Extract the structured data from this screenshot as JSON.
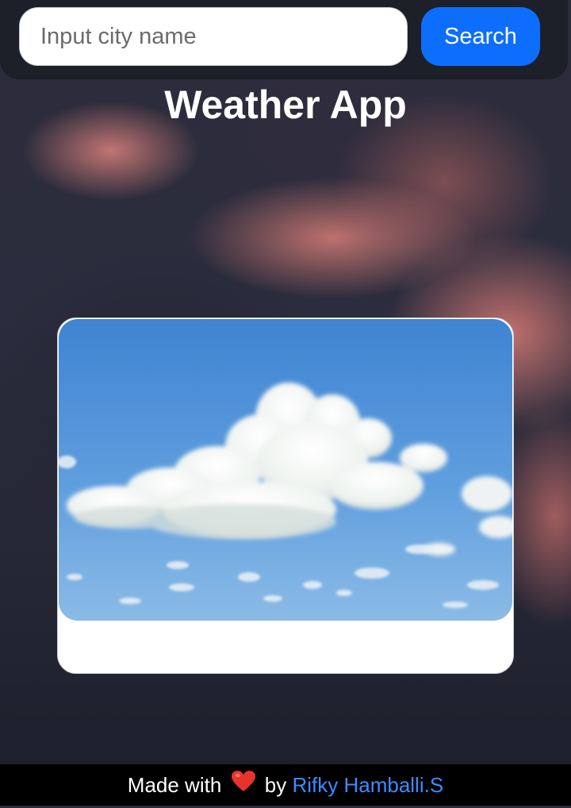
{
  "search": {
    "placeholder": "Input city name",
    "value": "",
    "button_label": "Search"
  },
  "header": {
    "title": "Weather App"
  },
  "weather_card": {
    "image_icon": "cloudy-sky-image"
  },
  "footer": {
    "made_with": "Made with",
    "heart_icon": "heart-icon",
    "by": "by",
    "author": "Rifky Hamballi.S"
  },
  "colors": {
    "accent": "#0d6efd",
    "link": "#3d8bfd",
    "title": "#ffffff",
    "footer_bg": "#000000",
    "heart": "#e8332a"
  }
}
